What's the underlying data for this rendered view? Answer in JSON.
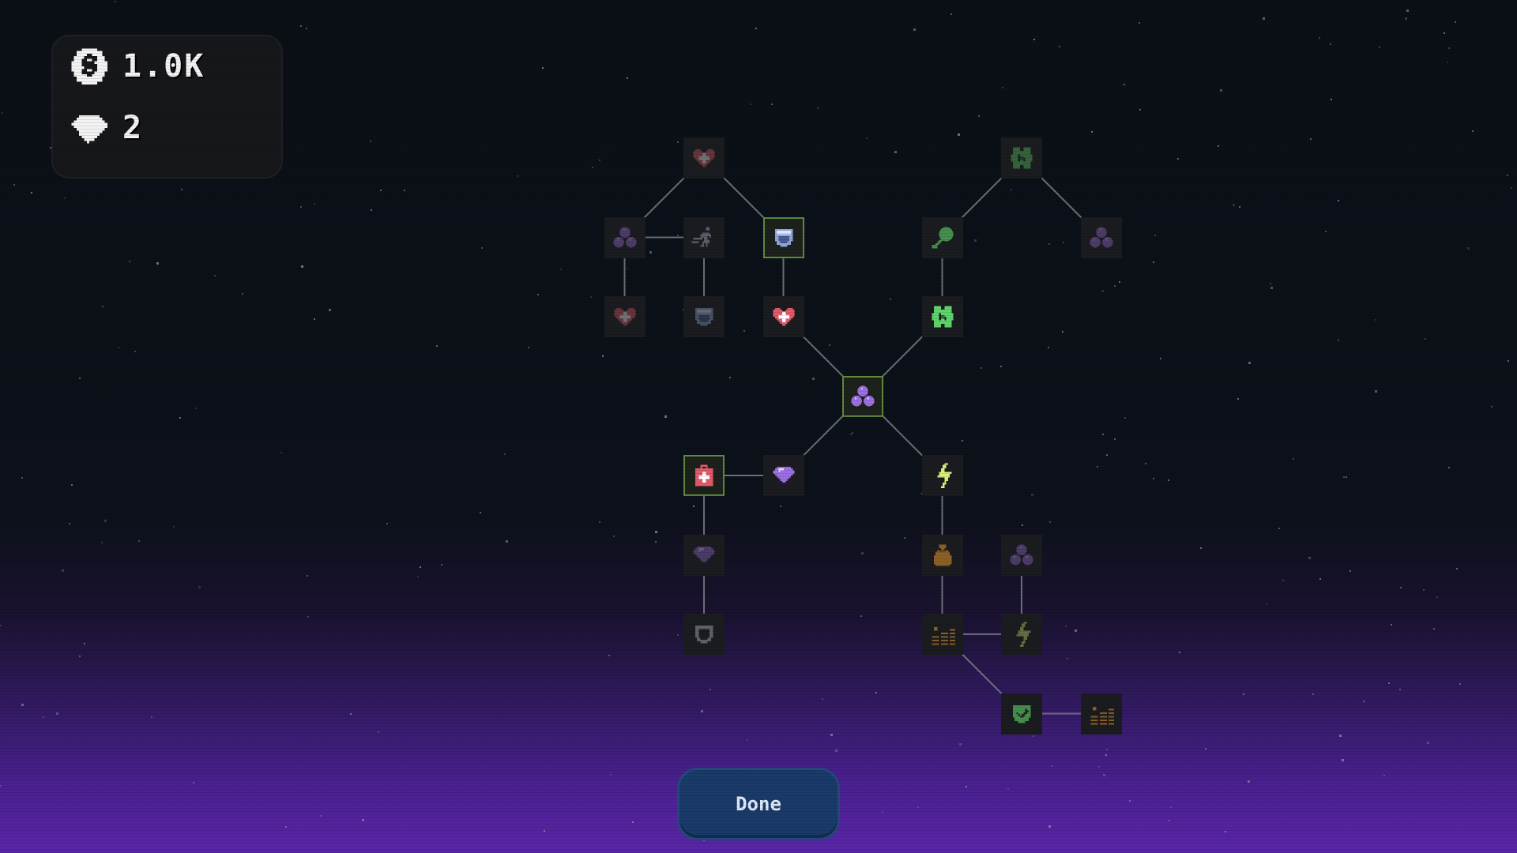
{
  "resources": {
    "coins": {
      "icon": "coin-icon",
      "value": "1.0K"
    },
    "gems": {
      "icon": "gem-icon",
      "value": "2"
    }
  },
  "colors": {
    "selected_border": "#5f8a3e",
    "node_bg": "#1b1c1f",
    "line": "#8a8f96",
    "button_bg": "#1a3a6a",
    "heart": "#e05a6a",
    "shield": "#8ea6e0",
    "clover": "#5fd46a",
    "orbs": "#9b6fe0",
    "lightning": "#d8f07a",
    "gold": "#d08a2a"
  },
  "upgrade_tree": {
    "nodes": [
      {
        "id": "n1",
        "icon": "heart-icon",
        "state": "dim",
        "col": 2,
        "row": 0
      },
      {
        "id": "n2",
        "icon": "clover-icon",
        "state": "dim",
        "col": 6,
        "row": 0
      },
      {
        "id": "n3",
        "icon": "orbs-icon",
        "state": "dim",
        "col": 1,
        "row": 1
      },
      {
        "id": "n4",
        "icon": "running-figure-icon",
        "state": "dim",
        "col": 2,
        "row": 1
      },
      {
        "id": "n5",
        "icon": "shield-icon",
        "state": "selected",
        "col": 3,
        "row": 1
      },
      {
        "id": "n6",
        "icon": "magnet-icon",
        "state": "mid",
        "col": 5,
        "row": 1
      },
      {
        "id": "n7",
        "icon": "orbs-icon",
        "state": "dim",
        "col": 7,
        "row": 1
      },
      {
        "id": "n8",
        "icon": "heart-icon",
        "state": "dim",
        "col": 1,
        "row": 2
      },
      {
        "id": "n9",
        "icon": "shield-icon",
        "state": "dim",
        "col": 2,
        "row": 2
      },
      {
        "id": "n10",
        "icon": "heart-icon",
        "state": "bright",
        "col": 3,
        "row": 2
      },
      {
        "id": "n11",
        "icon": "clover-icon",
        "state": "bright",
        "col": 5,
        "row": 2
      },
      {
        "id": "n12",
        "icon": "orbs-icon",
        "state": "selected",
        "col": 4,
        "row": 3
      },
      {
        "id": "n13",
        "icon": "medkit-icon",
        "state": "selected",
        "col": 2,
        "row": 4
      },
      {
        "id": "n14",
        "icon": "gem-icon",
        "state": "bright",
        "col": 3,
        "row": 4
      },
      {
        "id": "n15",
        "icon": "lightning-icon",
        "state": "bright",
        "col": 5,
        "row": 4
      },
      {
        "id": "n16",
        "icon": "gem-icon",
        "state": "dim",
        "col": 2,
        "row": 5
      },
      {
        "id": "n17",
        "icon": "money-bag-icon",
        "state": "mid",
        "col": 5,
        "row": 5
      },
      {
        "id": "n18",
        "icon": "orbs-icon",
        "state": "dim",
        "col": 6,
        "row": 5
      },
      {
        "id": "n19",
        "icon": "shield-outline-icon",
        "state": "dim",
        "col": 2,
        "row": 6
      },
      {
        "id": "n20",
        "icon": "coin-stacks-icon",
        "state": "mid",
        "col": 5,
        "row": 6
      },
      {
        "id": "n21",
        "icon": "lightning-icon",
        "state": "dim",
        "col": 6,
        "row": 6
      },
      {
        "id": "n22",
        "icon": "check-shield-icon",
        "state": "mid",
        "col": 6,
        "row": 7
      },
      {
        "id": "n23",
        "icon": "coin-stacks-icon",
        "state": "mid",
        "col": 7,
        "row": 7
      }
    ],
    "edges": [
      [
        "n1",
        "n3"
      ],
      [
        "n1",
        "n5"
      ],
      [
        "n3",
        "n4"
      ],
      [
        "n3",
        "n8"
      ],
      [
        "n4",
        "n9"
      ],
      [
        "n5",
        "n10"
      ],
      [
        "n10",
        "n12"
      ],
      [
        "n2",
        "n6"
      ],
      [
        "n2",
        "n7"
      ],
      [
        "n6",
        "n11"
      ],
      [
        "n11",
        "n12"
      ],
      [
        "n12",
        "n14"
      ],
      [
        "n12",
        "n15"
      ],
      [
        "n13",
        "n14"
      ],
      [
        "n13",
        "n16"
      ],
      [
        "n16",
        "n19"
      ],
      [
        "n15",
        "n17"
      ],
      [
        "n17",
        "n20"
      ],
      [
        "n18",
        "n21"
      ],
      [
        "n20",
        "n21"
      ],
      [
        "n20",
        "n22"
      ],
      [
        "n22",
        "n23"
      ]
    ]
  },
  "done_button": {
    "label": "Done"
  }
}
